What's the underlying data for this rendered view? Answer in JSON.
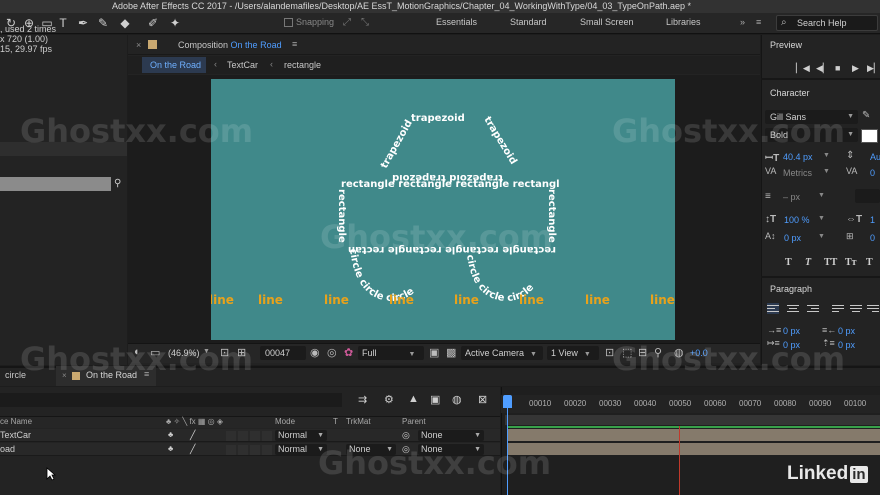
{
  "window": {
    "title": "Adobe After Effects CC 2017 - /Users/alandemafiles/Desktop/AE EssT_MotionGraphics/Chapter_04_WorkingWithType/04_03_TypeOnPath.aep *"
  },
  "toolbar": {
    "snapping_label": "Snapping",
    "workspaces": [
      "Essentials",
      "Standard",
      "Small Screen",
      "Libraries"
    ],
    "search_placeholder": "Search Help"
  },
  "project": {
    "info_lines": [
      ", used 2 times",
      "x 720 (1.00)",
      "15, 29.97 fps"
    ]
  },
  "composition": {
    "tab_prefix": "Composition",
    "tab_name": "On the Road",
    "breadcrumbs": [
      "On the Road",
      "TextCar",
      "rectangle"
    ],
    "canvas_bg": "#40898a",
    "shape_words": {
      "trapezoid": "trapezoid",
      "rectangle": "rectangle",
      "circle": "circle",
      "line": "line"
    },
    "footer": {
      "zoom": "(46.9%)",
      "timecode": "00047",
      "resolution": "Full",
      "camera": "Active Camera",
      "views": "1 View",
      "exposure": "+0.0"
    }
  },
  "preview": {
    "title": "Preview"
  },
  "character": {
    "title": "Character",
    "font_family": "Gill Sans",
    "font_style": "Bold",
    "font_size": "40.4 px",
    "kerning": "Metrics",
    "leading": "– px",
    "vscale": "100 %",
    "baseline": "0 px",
    "tracking": "Au",
    "tsume": "0",
    "hscale": "1",
    "tsume2": "0",
    "text_styles": [
      "T",
      "T",
      "TT",
      "Tт",
      "T"
    ]
  },
  "paragraph": {
    "title": "Paragraph",
    "indent_left": "0 px",
    "indent_right": "0 px",
    "indent_first": "0 px",
    "space_before": "0 px",
    "space_after": "0 px"
  },
  "timeline": {
    "tabs": [
      "circle",
      "On the Road"
    ],
    "columns": [
      "ce Name",
      "Mode",
      "T",
      "TrkMat",
      "Parent"
    ],
    "layers": [
      {
        "name": "TextCar",
        "mode": "Normal",
        "trkmat": "",
        "parent": "None"
      },
      {
        "name": "oad",
        "mode": "Normal",
        "trkmat": "None",
        "parent": "None"
      }
    ],
    "ruler_ticks": [
      "00010",
      "00020",
      "00030",
      "00040",
      "00050",
      "00060",
      "00070",
      "00080",
      "00090",
      "00100"
    ],
    "colors": {
      "layer_bar": "#857a6b",
      "current_time": "#4f9dff",
      "work_end": "#c0392b",
      "accent_green": "#38a04a"
    }
  },
  "watermark": "Ghostxx.com",
  "branding": {
    "linkedin_text": "Linked",
    "linkedin_in": "in"
  }
}
